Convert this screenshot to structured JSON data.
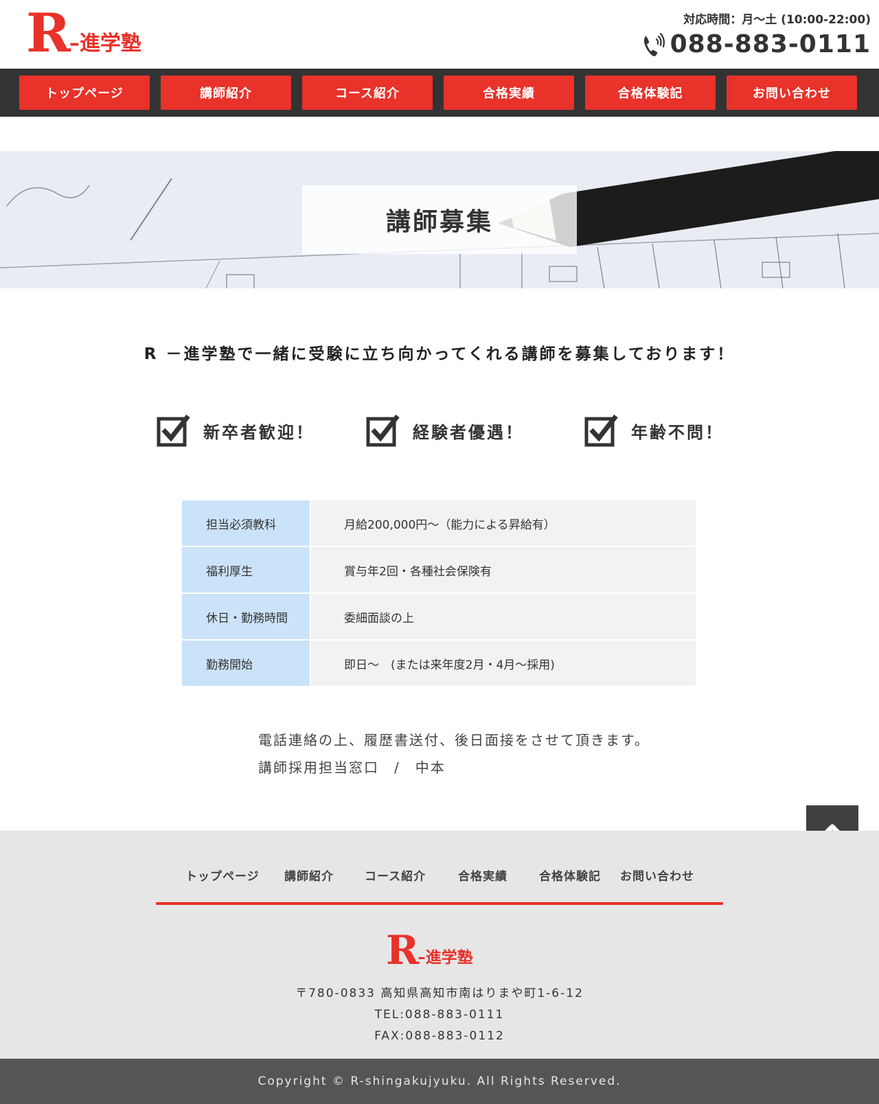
{
  "header": {
    "logo_mark": "R",
    "logo_text": "–進学塾",
    "hours": "対応時間：月～土 (10:00-22:00)",
    "phone": "088-883-0111",
    "phone_icon": "phone-icon"
  },
  "nav": {
    "items": [
      {
        "label": "トップページ"
      },
      {
        "label": "講師紹介"
      },
      {
        "label": "コース紹介"
      },
      {
        "label": "合格実績"
      },
      {
        "label": "合格体験記"
      },
      {
        "label": "お問い合わせ"
      }
    ]
  },
  "hero": {
    "title": "講師募集"
  },
  "main": {
    "lead": "R －進学塾で一緒に受験に立ち向かってくれる講師を募集しております！",
    "checks": [
      {
        "label": "新卒者歓迎！"
      },
      {
        "label": "経験者優遇！"
      },
      {
        "label": "年齢不問！"
      }
    ],
    "table": [
      {
        "head": "担当必須教科",
        "value": "月給200,000円～（能力による昇給有）"
      },
      {
        "head": "福利厚生",
        "value": "賞与年2回・各種社会保険有"
      },
      {
        "head": "休日・勤務時間",
        "value": "委細面談の上"
      },
      {
        "head": "勤務開始",
        "value": "即日～　(または来年度2月・4月～採用)"
      }
    ],
    "note_line1": "電話連絡の上、履歴書送付、後日面接をさせて頂きます。",
    "note_line2": "講師採用担当窓口　/　中本"
  },
  "footer": {
    "nav": [
      {
        "label": "トップページ"
      },
      {
        "label": "講師紹介"
      },
      {
        "label": "コース紹介"
      },
      {
        "label": "合格実績"
      },
      {
        "label": "合格体験記"
      },
      {
        "label": "お問い合わせ"
      }
    ],
    "logo_mark": "R",
    "logo_text": "–進学塾",
    "address": "〒780-0833 高知県高知市南はりまや町1-6-12",
    "tel": "TEL:088-883-0111",
    "fax": "FAX:088-883-0112",
    "copyright": "Copyright © R-shingakujyuku. All Rights Reserved."
  },
  "colors": {
    "brand_red": "#e8322a",
    "nav_bg": "#333333",
    "table_head": "#cbe3f8",
    "table_cell": "#f2f2f2",
    "footer_bg": "#e6e6e6",
    "copyright_bg": "#555555"
  },
  "icons": {
    "check": "checkbox-checked-icon",
    "totop": "chevron-up-icon"
  }
}
